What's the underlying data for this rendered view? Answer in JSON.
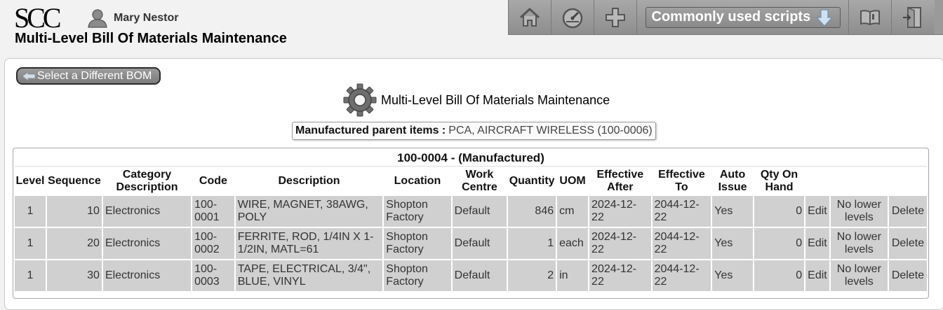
{
  "app": {
    "logo": "SCC",
    "user_name": "Mary Nestor",
    "page_title": "Multi-Level Bill Of Materials Maintenance"
  },
  "toolbar": {
    "scripts_label": "Commonly used scripts",
    "icons": [
      "home-icon",
      "dashboard-icon",
      "plus-icon",
      "book-icon",
      "exit-icon"
    ]
  },
  "main": {
    "back_button_label": "Select a Different BOM",
    "section_title": "Multi-Level Bill Of Materials Maintenance",
    "parent_label": "Manufactured parent items :",
    "parent_value": "PCA, AIRCRAFT WIRELESS (100-0006)"
  },
  "bom_table": {
    "caption": "100-0004 - (Manufactured)",
    "headers": {
      "level": "Level",
      "sequence": "Sequence",
      "category": "Category Description",
      "code": "Code",
      "description": "Description",
      "location": "Location",
      "work_centre": "Work Centre",
      "quantity": "Quantity",
      "uom": "UOM",
      "effective_after": "Effective After",
      "effective_to": "Effective To",
      "auto_issue": "Auto Issue",
      "qty_on_hand": "Qty On Hand"
    },
    "rows": [
      {
        "level": "1",
        "sequence": "10",
        "category": "Electronics",
        "code": "100-0001",
        "description": "WIRE, MAGNET, 38AWG, POLY",
        "location": "Shopton Factory",
        "work_centre": "Default",
        "quantity": "846",
        "uom": "cm",
        "effective_after": "2024-12-22",
        "effective_to": "2044-12-22",
        "auto_issue": "Yes",
        "qty_on_hand": "0",
        "edit": "Edit",
        "lower_levels": "No lower levels",
        "delete": "Delete"
      },
      {
        "level": "1",
        "sequence": "20",
        "category": "Electronics",
        "code": "100-0002",
        "description": "FERRITE, ROD, 1/4IN X 1-1/2IN, MATL=61",
        "location": "Shopton Factory",
        "work_centre": "Default",
        "quantity": "1",
        "uom": "each",
        "effective_after": "2024-12-22",
        "effective_to": "2044-12-22",
        "auto_issue": "Yes",
        "qty_on_hand": "0",
        "edit": "Edit",
        "lower_levels": "No lower levels",
        "delete": "Delete"
      },
      {
        "level": "1",
        "sequence": "30",
        "category": "Electronics",
        "code": "100-0003",
        "description": "TAPE, ELECTRICAL, 3/4\", BLUE, VINYL",
        "location": "Shopton Factory",
        "work_centre": "Default",
        "quantity": "2",
        "uom": "in",
        "effective_after": "2024-12-22",
        "effective_to": "2044-12-22",
        "auto_issue": "Yes",
        "qty_on_hand": "0",
        "edit": "Edit",
        "lower_levels": "No lower levels",
        "delete": "Delete"
      }
    ]
  }
}
